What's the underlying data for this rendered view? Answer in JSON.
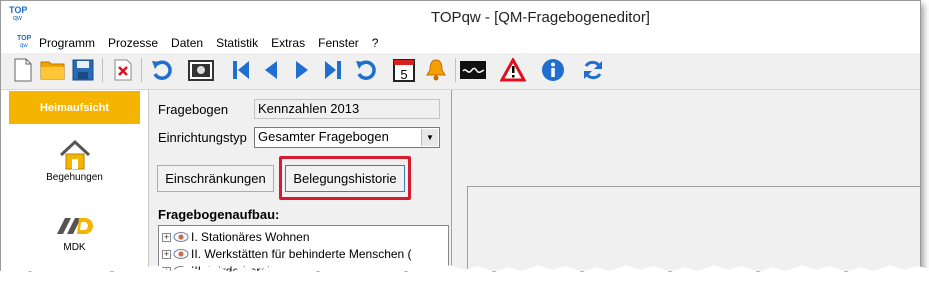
{
  "app": {
    "title": "TOPqw - [QM-Fragebogeneditor]",
    "logo_top": "TOP",
    "logo_bottom": "qw"
  },
  "menu": {
    "items": [
      {
        "label": "Programm"
      },
      {
        "label": "Prozesse"
      },
      {
        "label": "Daten"
      },
      {
        "label": "Statistik"
      },
      {
        "label": "Extras"
      },
      {
        "label": "Fenster"
      },
      {
        "label": "?"
      }
    ]
  },
  "toolbar": {
    "calendar_day": "5",
    "icons": [
      "new-document-icon",
      "open-folder-icon",
      "save-disk-icon",
      "delete-icon",
      "undo-icon",
      "camera-icon",
      "first-record-icon",
      "previous-record-icon",
      "next-record-icon",
      "last-record-icon",
      "refresh-record-icon",
      "calendar-icon",
      "bell-icon",
      "signature-icon",
      "warning-icon",
      "info-icon",
      "reload-icon"
    ]
  },
  "sidebar": {
    "active": {
      "label": "Heimaufsicht"
    },
    "items": [
      {
        "label": "Begehungen",
        "icon": "house-icon"
      },
      {
        "label": "MDK",
        "icon": "mdk-logo-icon"
      }
    ]
  },
  "form": {
    "fragebogen_label": "Fragebogen",
    "fragebogen_value": "Kennzahlen 2013",
    "einrichtungstyp_label": "Einrichtungstyp",
    "einrichtungstyp_value": "Gesamter Fragebogen",
    "einschraenkungen_button": "Einschränkungen",
    "belegungshistorie_button": "Belegungshistorie",
    "aufbau_heading": "Fragebogenaufbau:"
  },
  "tree": {
    "items": [
      {
        "label": "I. Stationäres Wohnen"
      },
      {
        "label": "II. Werkstätten für behinderte Menschen ("
      },
      {
        "label": "III. Förderbereich"
      }
    ]
  },
  "colors": {
    "accent_orange": "#f5b400",
    "highlight_red": "#d91a2e",
    "toolbar_blue": "#1a6fc8"
  }
}
